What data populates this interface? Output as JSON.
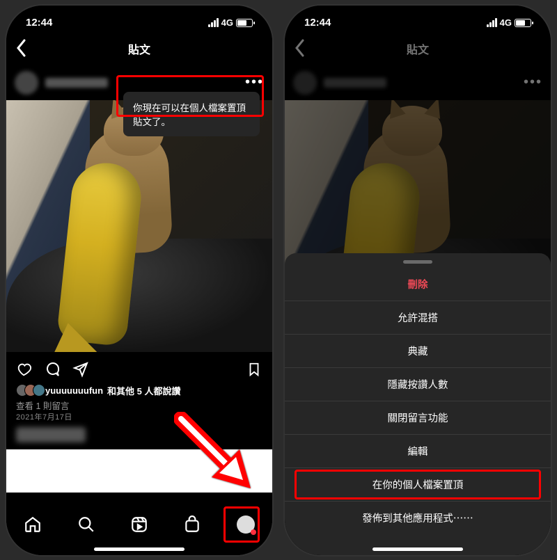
{
  "status": {
    "time": "12:44",
    "network": "4G"
  },
  "nav": {
    "title": "貼文"
  },
  "tooltip": {
    "text": "你現在可以在個人檔案置頂貼文了。"
  },
  "post": {
    "likes_handle": "yuuuuuuufun",
    "likes_suffix": " 和其他 5 人都說讚",
    "view_comments": "查看 1 則留言",
    "date": "2021年7月17日"
  },
  "sheet": {
    "items": [
      {
        "label": "刪除",
        "danger": true
      },
      {
        "label": "允許混搭",
        "danger": false
      },
      {
        "label": "典藏",
        "danger": false
      },
      {
        "label": "隱藏按讚人數",
        "danger": false
      },
      {
        "label": "關閉留言功能",
        "danger": false
      },
      {
        "label": "編輯",
        "danger": false
      },
      {
        "label": "在你的個人檔案置頂",
        "danger": false,
        "highlight": true
      },
      {
        "label": "發佈到其他應用程式⋯⋯",
        "danger": false
      }
    ]
  }
}
